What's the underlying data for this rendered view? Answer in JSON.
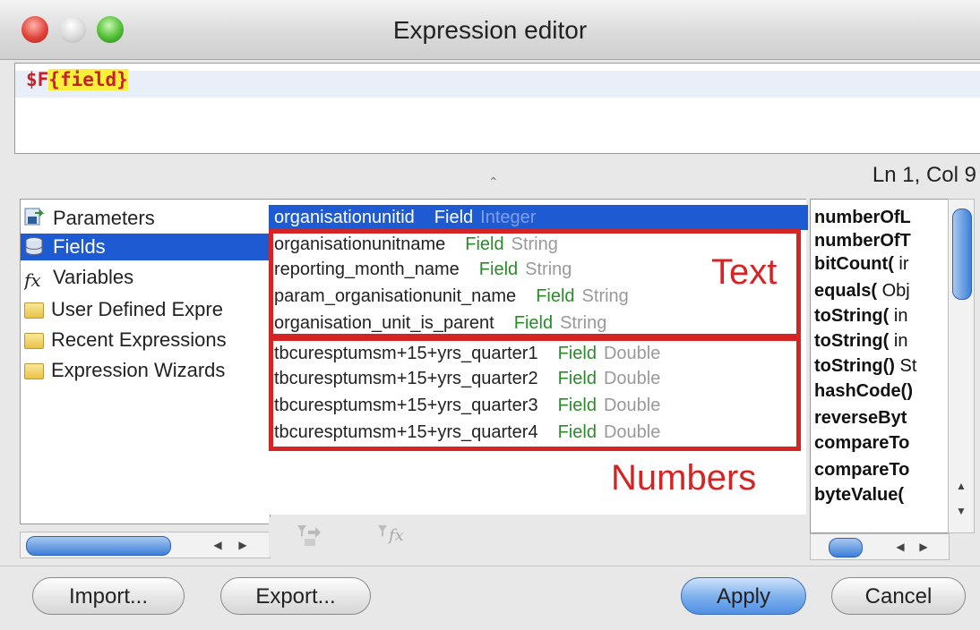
{
  "window": {
    "title": "Expression editor"
  },
  "editor": {
    "expression_prefix": "$F",
    "expression_field": "{field}",
    "cursor_position": "Ln 1, Col 9"
  },
  "tree": {
    "items": [
      {
        "label": "Parameters",
        "icon": "parameters-icon"
      },
      {
        "label": "Fields",
        "icon": "fields-icon",
        "selected": true
      },
      {
        "label": "Variables",
        "icon": "fx-icon"
      },
      {
        "label": "User Defined Expre",
        "icon": "folder-icon"
      },
      {
        "label": "Recent Expressions",
        "icon": "folder-icon"
      },
      {
        "label": "Expression Wizards",
        "icon": "folder-icon"
      }
    ]
  },
  "fields": [
    {
      "name": "organisationunitid",
      "kind": "Field",
      "type": "Integer",
      "selected": true
    },
    {
      "name": "organisationunitname",
      "kind": "Field",
      "type": "String"
    },
    {
      "name": "reporting_month_name",
      "kind": "Field",
      "type": "String"
    },
    {
      "name": "param_organisationunit_name",
      "kind": "Field",
      "type": "String"
    },
    {
      "name": "organisation_unit_is_parent",
      "kind": "Field",
      "type": "String"
    },
    {
      "name": "tbcuresptumsm+15+yrs_quarter1",
      "kind": "Field",
      "type": "Double"
    },
    {
      "name": "tbcuresptumsm+15+yrs_quarter2",
      "kind": "Field",
      "type": "Double"
    },
    {
      "name": "tbcuresptumsm+15+yrs_quarter3",
      "kind": "Field",
      "type": "Double"
    },
    {
      "name": "tbcuresptumsm+15+yrs_quarter4",
      "kind": "Field",
      "type": "Double"
    }
  ],
  "annotations": {
    "text_label": "Text",
    "numbers_label": "Numbers",
    "color": "#d42424"
  },
  "functions": [
    {
      "name": "numberOfL",
      "args": ""
    },
    {
      "name": "numberOfT",
      "args": ""
    },
    {
      "name": "bitCount(",
      "args": " ir"
    },
    {
      "name": "equals(",
      "args": " Obj"
    },
    {
      "name": "toString(",
      "args": " in"
    },
    {
      "name": "toString(",
      "args": " in"
    },
    {
      "name": "toString()",
      "args": " St"
    },
    {
      "name": "hashCode()",
      "args": ""
    },
    {
      "name": "reverseByt",
      "args": ""
    },
    {
      "name": "compareTo",
      "args": ""
    },
    {
      "name": "compareTo",
      "args": ""
    },
    {
      "name": "byteValue(",
      "args": ""
    }
  ],
  "buttons": {
    "import": "Import...",
    "export": "Export...",
    "apply": "Apply",
    "cancel": "Cancel"
  },
  "colors": {
    "selection": "#1e5bd3",
    "field_kind": "#2a8b2a",
    "expression": "#c8202a",
    "highlight": "#f7ef3a"
  }
}
